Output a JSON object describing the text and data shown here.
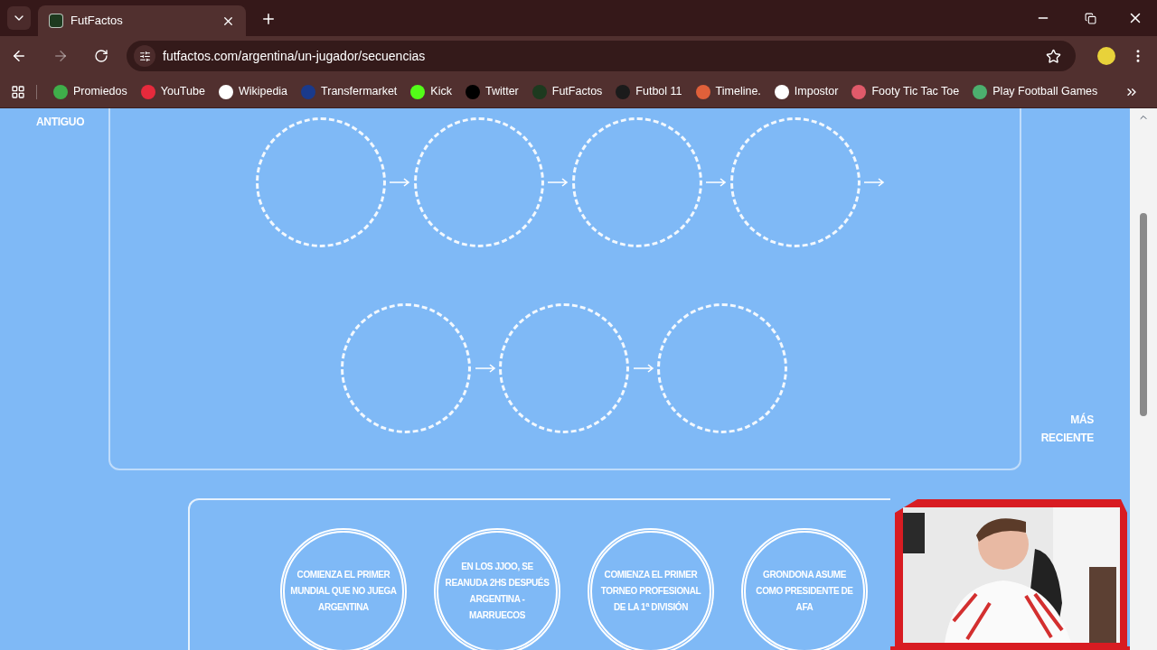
{
  "tabs": [
    {
      "title": "FutFactos",
      "selected": true
    }
  ],
  "address_bar": {
    "url": "futfactos.com/argentina/un-jugador/secuencias",
    "bookmarked": false
  },
  "bookmarks": [
    {
      "label": "Promiedos",
      "color": "#3fae4a"
    },
    {
      "label": "YouTube",
      "color": "#e62a3c"
    },
    {
      "label": "Wikipedia",
      "color": "#ffffff"
    },
    {
      "label": "Transfermarket",
      "color": "#1a3a8c"
    },
    {
      "label": "Kick",
      "color": "#53fc18"
    },
    {
      "label": "Twitter",
      "color": "#000000"
    },
    {
      "label": "FutFactos",
      "color": "#1d3a1f"
    },
    {
      "label": "Futbol 11",
      "color": "#1b1b1b"
    },
    {
      "label": "Timeline.",
      "color": "#e0603a"
    },
    {
      "label": "Impostor",
      "color": "#ffffff"
    },
    {
      "label": "Footy Tic Tac Toe",
      "color": "#e05a6a"
    },
    {
      "label": "Play Football Games",
      "color": "#4caf6e"
    }
  ],
  "timeline": {
    "label_start": "ANTIGUO",
    "label_end": "MÁS RECIENTE",
    "slot_rows": [
      {
        "slots": [
          {
            "kind": "empty"
          },
          {
            "kind": "empty"
          },
          {
            "kind": "empty"
          },
          {
            "kind": "empty"
          }
        ]
      },
      {
        "slots": [
          {
            "kind": "empty"
          },
          {
            "kind": "empty"
          },
          {
            "kind": "empty"
          }
        ]
      }
    ]
  },
  "cards": [
    {
      "text": "COMIENZA EL PRIMER MUNDIAL QUE NO JUEGA ARGENTINA"
    },
    {
      "text": "EN LOS JJOO, SE REANUDA 2HS DESPUÉS ARGENTINA - MARRUECOS"
    },
    {
      "text": "COMIENZA EL PRIMER TORNEO PROFESIONAL DE LA 1$^{a}$ DIVISIÓN"
    },
    {
      "text": "GRONDONA ASUME COMO PRESIDENTE DE AFA"
    }
  ]
}
